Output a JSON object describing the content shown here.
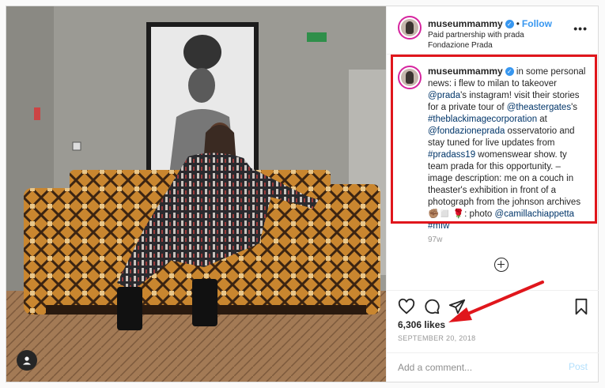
{
  "header": {
    "username": "museummammy",
    "verified_mark": "✓",
    "separator": "•",
    "follow_label": "Follow",
    "partnership": "Paid partnership with prada",
    "location": "Fondazione Prada",
    "more_icon": "more-horizontal-icon"
  },
  "caption": {
    "username": "museummammy",
    "segments": [
      {
        "text": " in some personal news: i flew to milan to takeover ",
        "tag": false
      },
      {
        "text": "@prada",
        "tag": true
      },
      {
        "text": "'s instagram! visit their stories for a private tour of ",
        "tag": false
      },
      {
        "text": "@theastergates",
        "tag": true
      },
      {
        "text": "'s ",
        "tag": false
      },
      {
        "text": "#theblackimagecorporation",
        "tag": true
      },
      {
        "text": " at ",
        "tag": false
      },
      {
        "text": "@fondazioneprada",
        "tag": true
      },
      {
        "text": " osservatorio and stay tuned for live updates from ",
        "tag": false
      },
      {
        "text": "#pradass19",
        "tag": true
      },
      {
        "text": " womenswear show. ty team prada for this opportunity. – image description: me on a couch in theaster's exhibition in front of a photograph from the johnson archives ✊🏽◻️ 🌹: photo ",
        "tag": false
      },
      {
        "text": "@camillachiappetta",
        "tag": true
      },
      {
        "text": " ",
        "tag": false
      },
      {
        "text": "#mfw",
        "tag": true
      }
    ]
  },
  "time_ago": "97w",
  "load_more_icon": "plus-circle-icon",
  "actions": {
    "icons": [
      "heart-icon",
      "comment-icon",
      "share-icon",
      "bookmark-icon"
    ],
    "likes": "6,306 likes",
    "date": "SEPTEMBER 20, 2018"
  },
  "comment": {
    "placeholder": "Add a comment...",
    "post_label": "Post"
  },
  "photo": {
    "tagged_user_icon": "user-tag-icon",
    "description": "woman in patterned dress sitting on a couch in front of a framed photograph"
  },
  "annotations": {
    "highlight_color": "#e0161c"
  },
  "colors": {
    "link": "#3897f0",
    "hashtag": "#003569",
    "muted": "#999999"
  }
}
